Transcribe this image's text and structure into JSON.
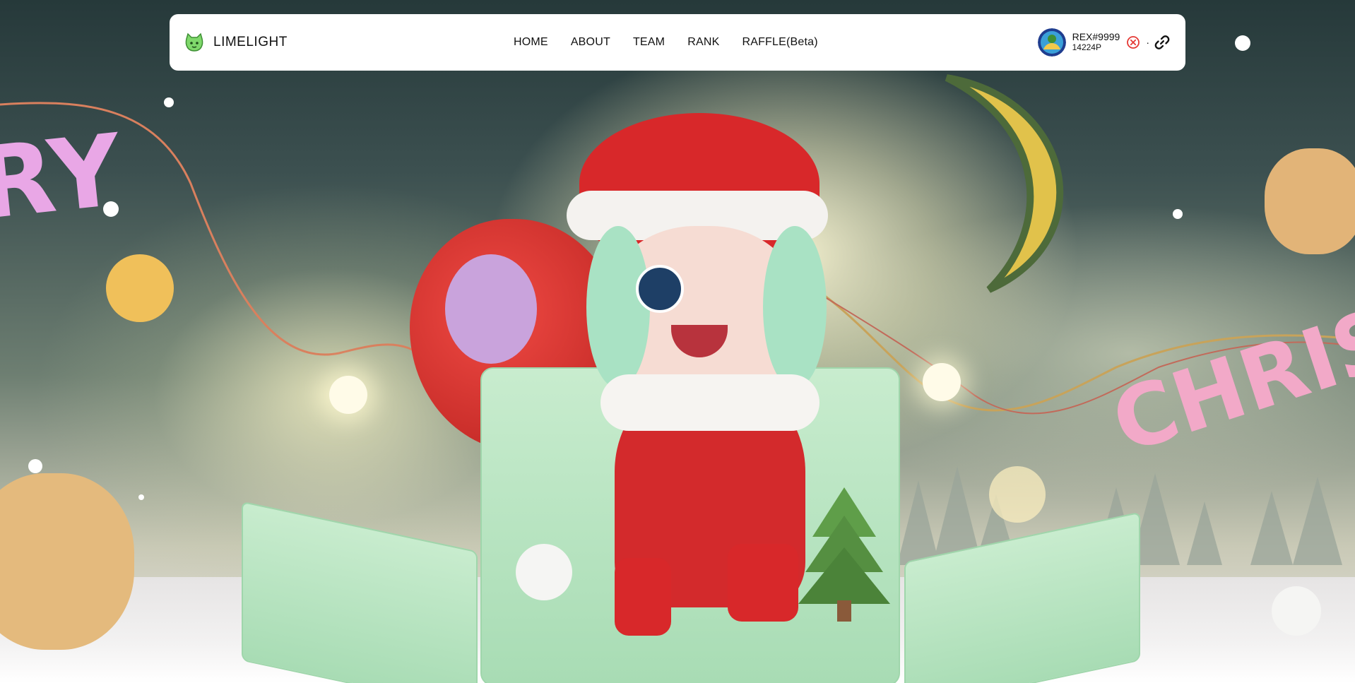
{
  "brand": {
    "name": "LIMELIGHT",
    "logo_icon": "lime-cat-logo-icon"
  },
  "nav": {
    "items": [
      {
        "label": "HOME"
      },
      {
        "label": "ABOUT"
      },
      {
        "label": "TEAM"
      },
      {
        "label": "RANK"
      },
      {
        "label": "RAFFLE(Beta)"
      }
    ]
  },
  "user": {
    "name": "REX#9999",
    "points": "14224P",
    "disconnect_icon": "close-circle-icon",
    "separator": "·",
    "link_icon": "link-icon"
  },
  "hero": {
    "banner_left_letters": "RY",
    "banner_right_letters": "CHRIS"
  },
  "colors": {
    "nav_bg": "#ffffff",
    "text": "#111111",
    "disconnect_red": "#e53935",
    "accent_green": "#8ee08a"
  }
}
